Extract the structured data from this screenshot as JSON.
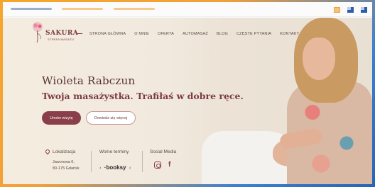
{
  "brand": {
    "name": "SAKURA",
    "subtitle": "STREFA MASAŻU"
  },
  "nav": {
    "items": [
      "STRONA GŁÓWNA",
      "O MNIE",
      "OFERTA",
      "AUTOMASAŻ",
      "BLOG",
      "CZĘSTE PYTANIA",
      "KONTAKT"
    ]
  },
  "hero": {
    "name": "Wioleta Rabczun",
    "tagline": "Twoja masażystka. Trafiłaś w dobre ręce.",
    "primary_button": "Umów wizytę",
    "secondary_button": "Dowiedz się więcej"
  },
  "info": {
    "location_title": "Lokalizacja",
    "address_line1": "Jaworowa 6,",
    "address_line2": "80-175 Gdańsk",
    "booking_title": "Wolne terminy",
    "booking_brand": "booksy",
    "social_title": "Social Media"
  },
  "colors": {
    "accent": "#8a3e4a",
    "heading": "#5a3238",
    "background": "#f1e9dd"
  },
  "icons": [
    "location-pin-icon",
    "instagram-icon",
    "facebook-icon",
    "chevron-right-icon",
    "chevron-left-icon"
  ]
}
